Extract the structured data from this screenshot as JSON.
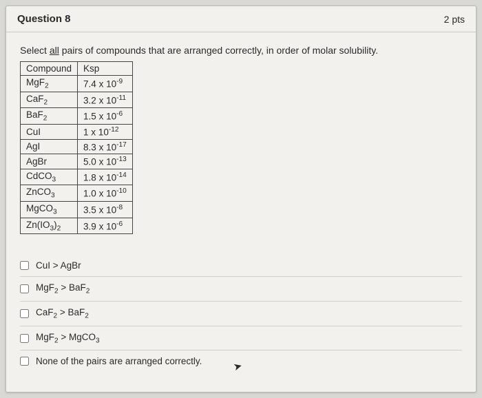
{
  "header": {
    "title": "Question 8",
    "points": "2 pts"
  },
  "prompt": {
    "prefix": "Select ",
    "underlined": "all",
    "suffix": " pairs of compounds that are arranged correctly, in order of molar solubility."
  },
  "table": {
    "headers": [
      "Compound",
      "Ksp"
    ],
    "rows": [
      {
        "compound_html": "MgF<sub>2</sub>",
        "ksp_html": "7.4 x 10<sup>-9</sup>"
      },
      {
        "compound_html": "CaF<sub>2</sub>",
        "ksp_html": "3.2 x 10<sup>-11</sup>"
      },
      {
        "compound_html": "BaF<sub>2</sub>",
        "ksp_html": "1.5 x 10<sup>-6</sup>"
      },
      {
        "compound_html": "CuI",
        "ksp_html": "1 x 10<sup>-12</sup>"
      },
      {
        "compound_html": "AgI",
        "ksp_html": "8.3 x 10<sup>-17</sup>"
      },
      {
        "compound_html": "AgBr",
        "ksp_html": "5.0 x 10<sup>-13</sup>"
      },
      {
        "compound_html": "CdCO<sub>3</sub>",
        "ksp_html": "1.8 x 10<sup>-14</sup>"
      },
      {
        "compound_html": "ZnCO<sub>3</sub>",
        "ksp_html": "1.0 x 10<sup>-10</sup>"
      },
      {
        "compound_html": "MgCO<sub>3</sub>",
        "ksp_html": "3.5 x 10<sup>-8</sup>"
      },
      {
        "compound_html": "Zn(IO<sub>3</sub>)<sub>2</sub>",
        "ksp_html": "3.9 x 10<sup>-6</sup>"
      }
    ]
  },
  "options": [
    {
      "html": "CuI > AgBr"
    },
    {
      "html": "MgF<sub>2</sub> > BaF<sub>2</sub>"
    },
    {
      "html": "CaF<sub>2</sub> > BaF<sub>2</sub>"
    },
    {
      "html": "MgF<sub>2</sub> > MgCO<sub>3</sub>"
    },
    {
      "html": "None of the pairs are arranged correctly."
    }
  ]
}
